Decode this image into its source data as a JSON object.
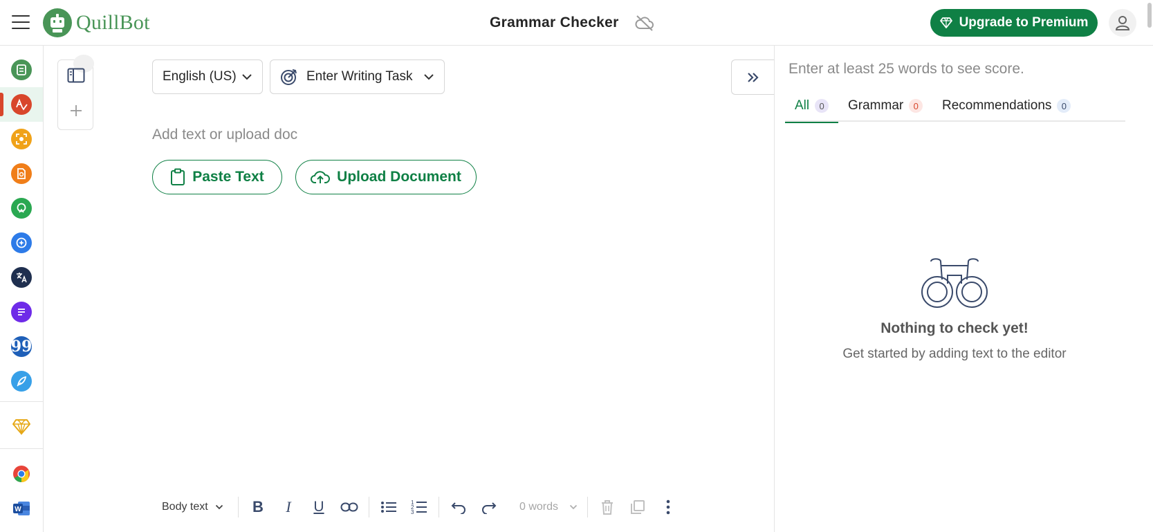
{
  "app": {
    "logo_text": "QuillBot",
    "title": "Grammar Checker",
    "upgrade_label": "Upgrade to Premium"
  },
  "icons": {
    "menu": "hamburger-menu-icon",
    "sync": "cloud-off-icon",
    "premium": "diamond-icon",
    "account": "user-icon"
  },
  "rail": {
    "items": [
      {
        "name": "paraphraser",
        "icon": "paraphraser-icon",
        "color": "#499557"
      },
      {
        "name": "grammar-checker",
        "icon": "grammar-check-icon",
        "color": "#d8462b",
        "active": true
      },
      {
        "name": "ai-detector",
        "icon": "ai-detector-icon",
        "color": "#f0a219"
      },
      {
        "name": "plagiarism-checker",
        "icon": "plagiarism-icon",
        "color": "#f07e19"
      },
      {
        "name": "ai-humanizer",
        "icon": "humanizer-icon",
        "color": "#2aa851"
      },
      {
        "name": "ai-chat",
        "icon": "chat-icon",
        "color": "#2d7be8"
      },
      {
        "name": "translator",
        "icon": "translate-icon",
        "color": "#1f2f4f"
      },
      {
        "name": "summarizer",
        "icon": "summarizer-icon",
        "color": "#6e2be8"
      },
      {
        "name": "citation-generator",
        "icon": "quote-icon",
        "color": "#1e5fb8"
      },
      {
        "name": "flow",
        "icon": "quill-icon",
        "color": "#38a0e8"
      },
      {
        "name": "premium",
        "icon": "diamond-icon",
        "color": "#e6a817"
      },
      {
        "name": "chrome-extension",
        "icon": "chrome-icon",
        "color": "#e8443a"
      },
      {
        "name": "word-addin",
        "icon": "word-icon",
        "color": "#2b5fb5"
      }
    ]
  },
  "editor": {
    "language": "English (US)",
    "writing_task": "Enter Writing Task",
    "placeholder": "Add text or upload doc",
    "paste_label": "Paste Text",
    "upload_label": "Upload Document"
  },
  "toolbar": {
    "text_style": "Body text",
    "word_count": "0 words"
  },
  "results": {
    "score_hint": "Enter at least 25 words to see score.",
    "tabs": [
      {
        "label": "All",
        "count": "0"
      },
      {
        "label": "Grammar",
        "count": "0"
      },
      {
        "label": "Recommendations",
        "count": "0"
      }
    ],
    "empty_title": "Nothing to check yet!",
    "empty_subtitle": "Get started by adding text to the editor"
  },
  "colors": {
    "brand_green": "#0f8045",
    "logo_green": "#499557",
    "grammar_red": "#d8462b"
  }
}
